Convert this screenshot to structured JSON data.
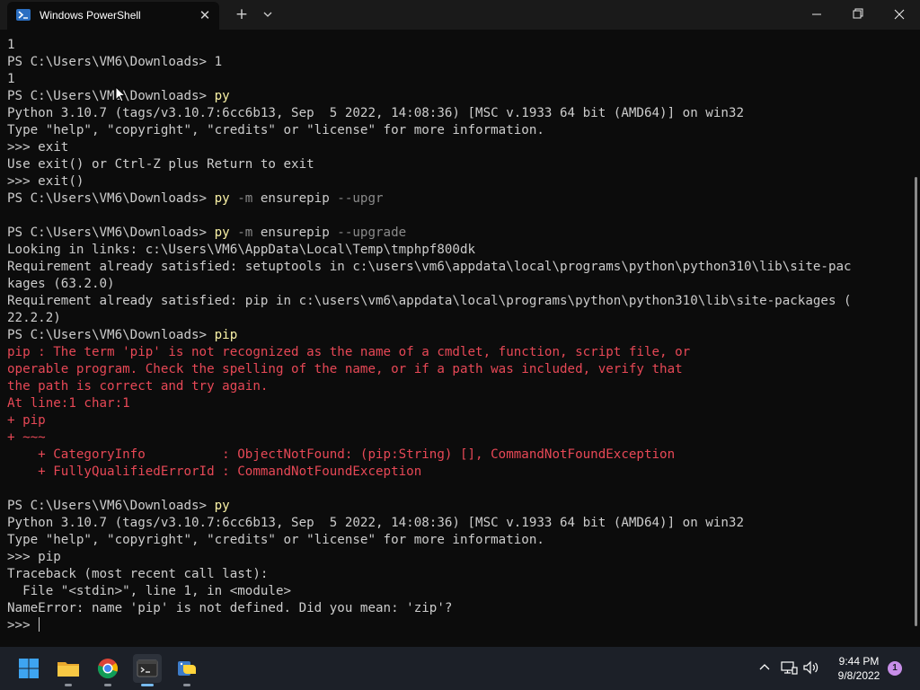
{
  "window": {
    "tab_title": "Windows PowerShell",
    "close_tab_glyph": "✕",
    "new_tab_glyph": "+"
  },
  "colors": {
    "background": "#0c0c0c",
    "text": "#cccccc",
    "command": "#f9f1a5",
    "parameter": "#8a8a8a",
    "error": "#e74856",
    "taskbar": "#1c2028"
  },
  "terminal": {
    "lines": [
      [
        {
          "t": "1",
          "c": "default"
        }
      ],
      [
        {
          "t": "PS C:\\Users\\VM6\\Downloads> ",
          "c": "default"
        },
        {
          "t": "1",
          "c": "default"
        }
      ],
      [
        {
          "t": "1",
          "c": "default"
        }
      ],
      [
        {
          "t": "PS C:\\Users\\VM6\\Downloads> ",
          "c": "default"
        },
        {
          "t": "py",
          "c": "cmd"
        }
      ],
      [
        {
          "t": "Python 3.10.7 (tags/v3.10.7:6cc6b13, Sep  5 2022, 14:08:36) [MSC v.1933 64 bit (AMD64)] on win32",
          "c": "default"
        }
      ],
      [
        {
          "t": "Type \"help\", \"copyright\", \"credits\" or \"license\" for more information.",
          "c": "default"
        }
      ],
      [
        {
          "t": ">>> exit",
          "c": "default"
        }
      ],
      [
        {
          "t": "Use exit() or Ctrl-Z plus Return to exit",
          "c": "default"
        }
      ],
      [
        {
          "t": ">>> exit()",
          "c": "default"
        }
      ],
      [
        {
          "t": "PS C:\\Users\\VM6\\Downloads> ",
          "c": "default"
        },
        {
          "t": "py",
          "c": "cmd"
        },
        {
          "t": " -m",
          "c": "param"
        },
        {
          "t": " ensurepip",
          "c": "default"
        },
        {
          "t": " --upgr",
          "c": "param"
        }
      ],
      [
        {
          "t": "",
          "c": "default"
        }
      ],
      [
        {
          "t": "PS C:\\Users\\VM6\\Downloads> ",
          "c": "default"
        },
        {
          "t": "py",
          "c": "cmd"
        },
        {
          "t": " -m",
          "c": "param"
        },
        {
          "t": " ensurepip",
          "c": "default"
        },
        {
          "t": " --upgrade",
          "c": "param"
        }
      ],
      [
        {
          "t": "Looking in links: c:\\Users\\VM6\\AppData\\Local\\Temp\\tmphpf800dk",
          "c": "default"
        }
      ],
      [
        {
          "t": "Requirement already satisfied: setuptools in c:\\users\\vm6\\appdata\\local\\programs\\python\\python310\\lib\\site-pac",
          "c": "default"
        }
      ],
      [
        {
          "t": "kages (63.2.0)",
          "c": "default"
        }
      ],
      [
        {
          "t": "Requirement already satisfied: pip in c:\\users\\vm6\\appdata\\local\\programs\\python\\python310\\lib\\site-packages (",
          "c": "default"
        }
      ],
      [
        {
          "t": "22.2.2)",
          "c": "default"
        }
      ],
      [
        {
          "t": "PS C:\\Users\\VM6\\Downloads> ",
          "c": "default"
        },
        {
          "t": "pip",
          "c": "cmd"
        }
      ],
      [
        {
          "t": "pip : The term 'pip' is not recognized as the name of a cmdlet, function, script file, or",
          "c": "error"
        }
      ],
      [
        {
          "t": "operable program. Check the spelling of the name, or if a path was included, verify that",
          "c": "error"
        }
      ],
      [
        {
          "t": "the path is correct and try again.",
          "c": "error"
        }
      ],
      [
        {
          "t": "At line:1 char:1",
          "c": "error"
        }
      ],
      [
        {
          "t": "+ pip",
          "c": "error"
        }
      ],
      [
        {
          "t": "+ ~~~",
          "c": "error"
        }
      ],
      [
        {
          "t": "    + CategoryInfo          : ObjectNotFound: (pip:String) [], CommandNotFoundException",
          "c": "error"
        }
      ],
      [
        {
          "t": "    + FullyQualifiedErrorId : CommandNotFoundException",
          "c": "error"
        }
      ],
      [
        {
          "t": "",
          "c": "default"
        }
      ],
      [
        {
          "t": "PS C:\\Users\\VM6\\Downloads> ",
          "c": "default"
        },
        {
          "t": "py",
          "c": "cmd"
        }
      ],
      [
        {
          "t": "Python 3.10.7 (tags/v3.10.7:6cc6b13, Sep  5 2022, 14:08:36) [MSC v.1933 64 bit (AMD64)] on win32",
          "c": "default"
        }
      ],
      [
        {
          "t": "Type \"help\", \"copyright\", \"credits\" or \"license\" for more information.",
          "c": "default"
        }
      ],
      [
        {
          "t": ">>> pip",
          "c": "default"
        }
      ],
      [
        {
          "t": "Traceback (most recent call last):",
          "c": "default"
        }
      ],
      [
        {
          "t": "  File \"<stdin>\", line 1, in <module>",
          "c": "default"
        }
      ],
      [
        {
          "t": "NameError: name 'pip' is not defined. Did you mean: 'zip'?",
          "c": "default"
        }
      ],
      [
        {
          "t": ">>> ",
          "c": "default"
        }
      ]
    ]
  },
  "taskbar": {
    "apps": [
      {
        "name": "start-button",
        "icon": "windows-logo-icon"
      },
      {
        "name": "file-explorer",
        "icon": "folder-icon"
      },
      {
        "name": "chrome",
        "icon": "chrome-icon"
      },
      {
        "name": "terminal",
        "icon": "terminal-icon"
      },
      {
        "name": "python",
        "icon": "python-icon"
      }
    ],
    "clock_time": "9:44 PM",
    "clock_date": "9/8/2022",
    "notification_count": "1"
  }
}
